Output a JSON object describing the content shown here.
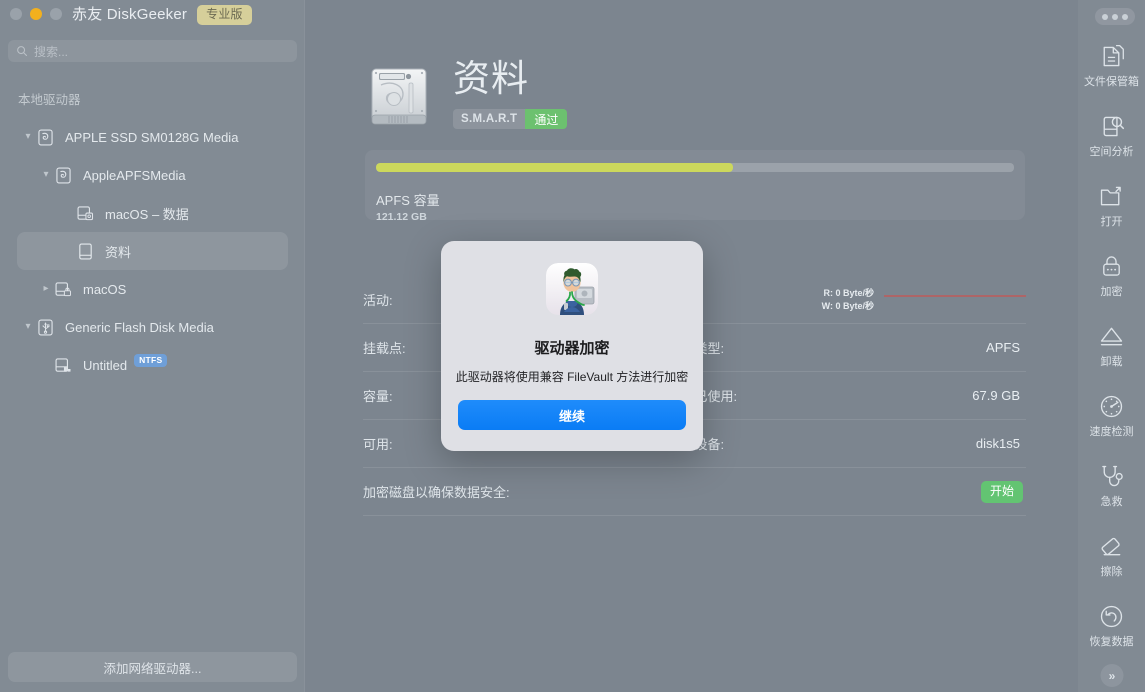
{
  "window": {
    "app_title": "赤友 DiskGeeker",
    "pro_badge": "专业版",
    "traffic_lights": [
      "close",
      "minimize",
      "zoom"
    ],
    "window_menu_icon": "ellipsis-icon"
  },
  "search": {
    "placeholder": "搜索...",
    "value": "",
    "icon": "search-icon"
  },
  "sidebar": {
    "section_label": "本地驱动器",
    "add_network_label": "添加网络驱动器...",
    "items": [
      {
        "label": "APPLE SSD SM0128G Media",
        "icon": "disk-icon",
        "indent": 1,
        "chevron": "down",
        "selected": false,
        "tag": ""
      },
      {
        "label": "AppleAPFSMedia",
        "icon": "disk-icon",
        "indent": 2,
        "chevron": "down",
        "selected": false,
        "tag": ""
      },
      {
        "label": "macOS – 数据",
        "icon": "volume-data-icon",
        "indent": 3,
        "chevron": "none",
        "selected": false,
        "tag": ""
      },
      {
        "label": "资料",
        "icon": "volume-icon",
        "indent": 3,
        "chevron": "none",
        "selected": true,
        "tag": ""
      },
      {
        "label": "macOS",
        "icon": "volume-lock-icon",
        "indent": 2,
        "chevron": "right",
        "selected": false,
        "tag": ""
      },
      {
        "label": "Generic Flash Disk Media",
        "icon": "usb-icon",
        "indent": 1,
        "chevron": "down",
        "selected": false,
        "tag": ""
      },
      {
        "label": "Untitled",
        "icon": "volume-ntfs-icon",
        "indent": 2,
        "chevron": "none",
        "selected": false,
        "tag": "NTFS"
      }
    ]
  },
  "main": {
    "disk_icon": "hard-drive-icon",
    "disk_title": "资料",
    "smart_key": "S.M.A.R.T",
    "smart_value": "通过",
    "capacity": {
      "name": "APFS 容量",
      "size": "121.12 GB",
      "used_percent": 56
    },
    "details": [
      {
        "key": "活动:",
        "value": "",
        "right_key": "",
        "right_value": "",
        "read_label": "R: 0 Byte/秒",
        "write_label": "W: 0 Byte/秒",
        "graph": true
      },
      {
        "key": "挂载点:",
        "value": "",
        "right_key": "类型:",
        "right_value": "APFS"
      },
      {
        "key": "容量:",
        "value": "",
        "right_key": "已使用:",
        "right_value": "67.9 GB"
      },
      {
        "key": "可用:",
        "value": "",
        "right_key": "设备:",
        "right_value": "disk1s5"
      }
    ],
    "encrypt_row": {
      "label": "加密磁盘以确保数据安全:",
      "button": "开始"
    }
  },
  "toolbar": {
    "items": [
      {
        "label": "文件保管箱",
        "icon": "file-vault-icon"
      },
      {
        "label": "空间分析",
        "icon": "space-analysis-icon"
      },
      {
        "label": "打开",
        "icon": "open-folder-icon"
      },
      {
        "label": "加密",
        "icon": "lock-icon"
      },
      {
        "label": "卸载",
        "icon": "eject-icon"
      },
      {
        "label": "速度检测",
        "icon": "speedometer-icon"
      },
      {
        "label": "急救",
        "icon": "stethoscope-icon"
      },
      {
        "label": "擦除",
        "icon": "eraser-icon"
      },
      {
        "label": "恢复数据",
        "icon": "undo-circle-icon"
      }
    ],
    "more_label": "»"
  },
  "modal": {
    "illustration": "technician-diagnosing-drive-icon",
    "title": "驱动器加密",
    "subtitle": "此驱动器将使用兼容 FileVault 方法进行加密",
    "primary_button": "继续"
  },
  "colors": {
    "app_background": "#7c858f",
    "sidebar_background": "#828b94",
    "accent_blue": "#0a7cf5",
    "smart_pass_green": "#6cc16f",
    "start_button_green": "#63c472",
    "capacity_fill": "#ccd85c",
    "ntfs_badge_blue": "#6f9fd8",
    "pro_badge_gold": "#d6cf9a",
    "activity_graph_red": "#e0453f"
  }
}
